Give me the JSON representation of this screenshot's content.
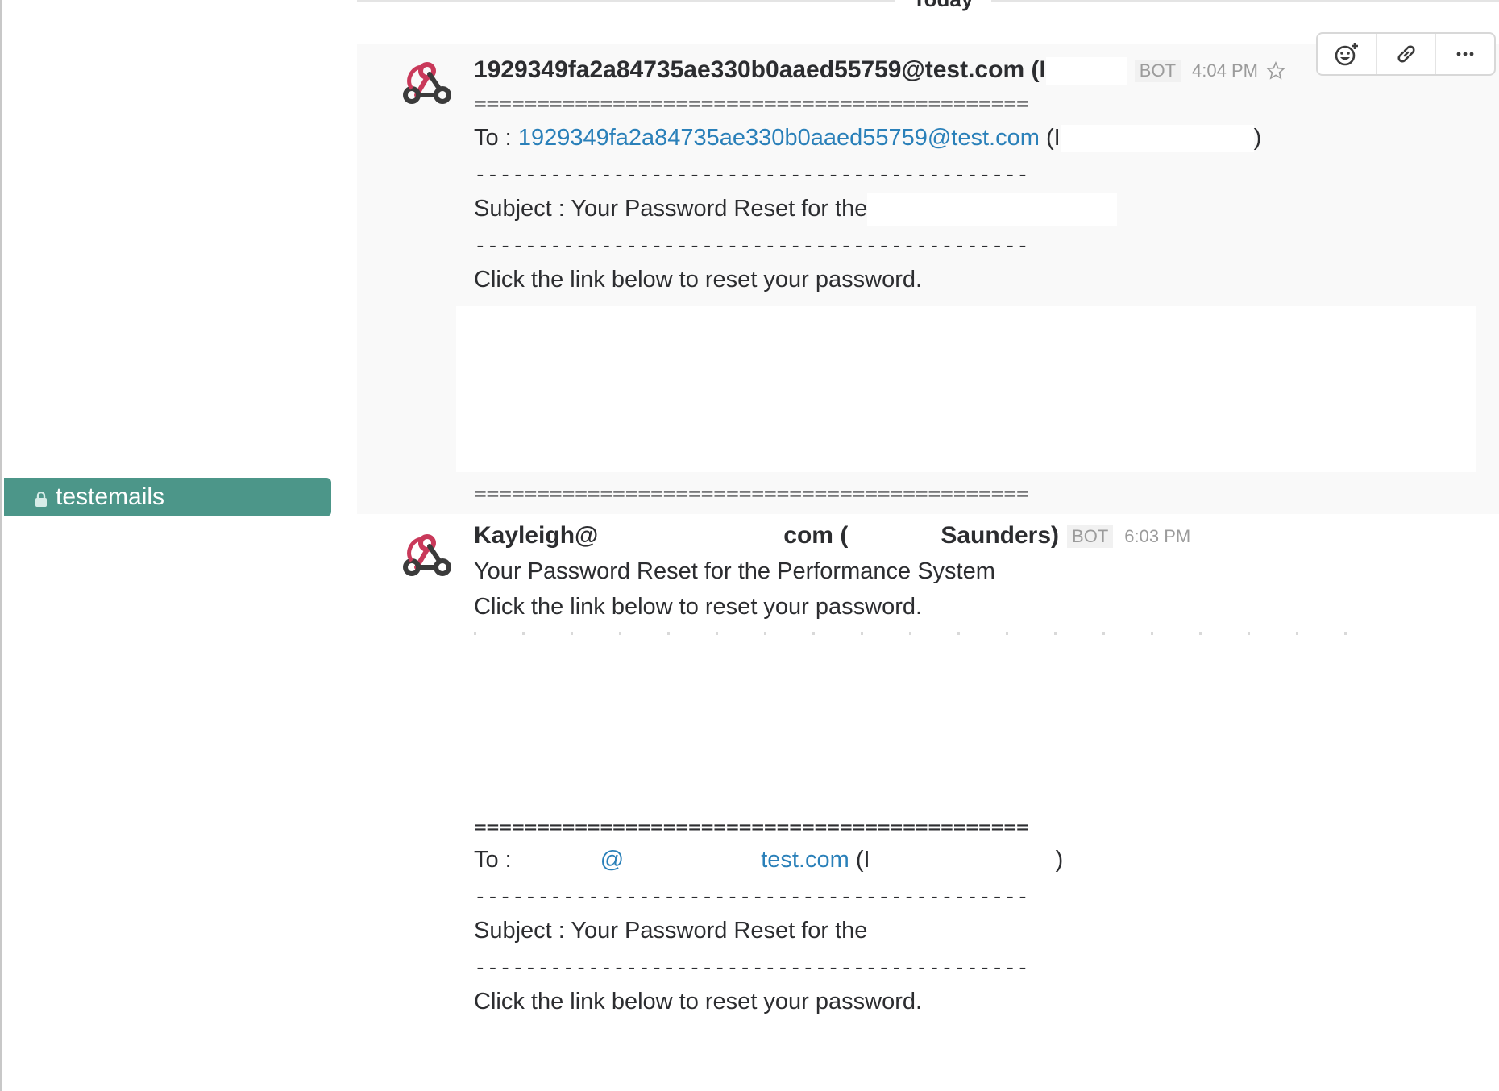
{
  "sidebar": {
    "active_channel": "testemails"
  },
  "day_divider": {
    "label": "Today"
  },
  "messages": [
    {
      "sender": "1929349fa2a84735ae330b0aaed55759@test.com (I",
      "badge": "BOT",
      "time": "4:04 PM",
      "equals_line": "============================================",
      "to_label": "To :",
      "to_link": "1929349fa2a84735ae330b0aaed55759@test.com",
      "to_paren_open": "(I",
      "to_paren_close": ")",
      "dash_line": "--------------------------------------------",
      "subject": "Subject : Your Password Reset for the",
      "body": "Click the link below to reset your password.",
      "equals_line_bottom": "============================================"
    },
    {
      "sender_a": "Kayleigh@",
      "sender_b": "com (",
      "sender_c": "Saunders)",
      "badge": "BOT",
      "time": "6:03 PM",
      "line1": "Your Password Reset for the Performance System",
      "line2": "Click the link below to reset your password.",
      "equals_line": "============================================",
      "to_label": "To :",
      "to_link_a": "@",
      "to_link_b": "test.com",
      "to_paren_open": "(I",
      "to_paren_close": ")",
      "dash_line": "--------------------------------------------",
      "subject": "Subject : Your Password Reset for the",
      "body": "Click the link below to reset your password."
    }
  ],
  "icons": {
    "avatar": "webhook-icon",
    "lock": "lock-icon",
    "star": "star-icon",
    "reaction": "add-reaction-icon",
    "link": "link-icon",
    "more": "more-icon"
  },
  "colors": {
    "sidebar_active": "#4c9689",
    "link": "#2a80b9",
    "webhook_red": "#c9395a",
    "webhook_dark": "#3b3b3b"
  }
}
